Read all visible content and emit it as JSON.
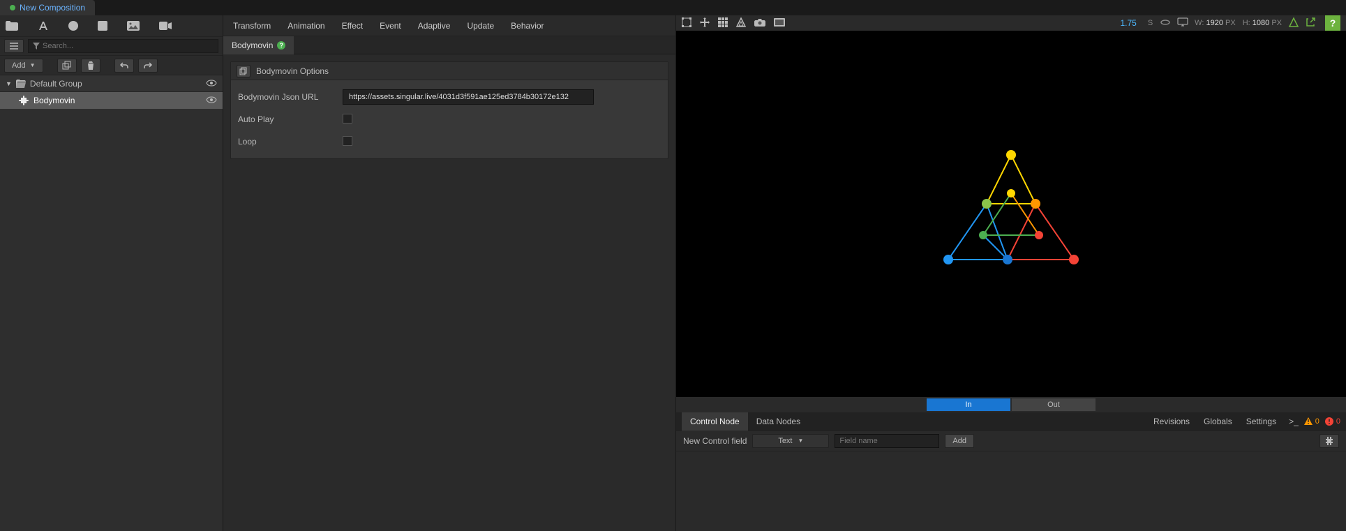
{
  "tab": {
    "label": "New Composition"
  },
  "left": {
    "search_placeholder": "Search...",
    "add_label": "Add",
    "tree": {
      "group": "Default Group",
      "item": "Bodymovin"
    }
  },
  "menu": [
    "Transform",
    "Animation",
    "Effect",
    "Event",
    "Adaptive",
    "Update",
    "Behavior"
  ],
  "sub_tab": {
    "label": "Bodymovin"
  },
  "props": {
    "section_title": "Bodymovin Options",
    "url_label": "Bodymovin Json URL",
    "url_value": "https://assets.singular.live/4031d3f591ae125ed3784b30172e132",
    "autoplay_label": "Auto Play",
    "loop_label": "Loop"
  },
  "canvas": {
    "zoom": "1.75",
    "unit": "S",
    "w_label": "W:",
    "w_value": "1920",
    "h_label": "H:",
    "h_value": "1080",
    "px": "PX"
  },
  "inout": {
    "in": "In",
    "out": "Out"
  },
  "bottom": {
    "tabs": [
      "Control Node",
      "Data Nodes"
    ],
    "actions": [
      "Revisions",
      "Globals",
      "Settings"
    ],
    "warn": "0",
    "err": "0",
    "new_field_label": "New Control field",
    "type_value": "Text",
    "field_placeholder": "Field name",
    "add_btn": "Add"
  }
}
